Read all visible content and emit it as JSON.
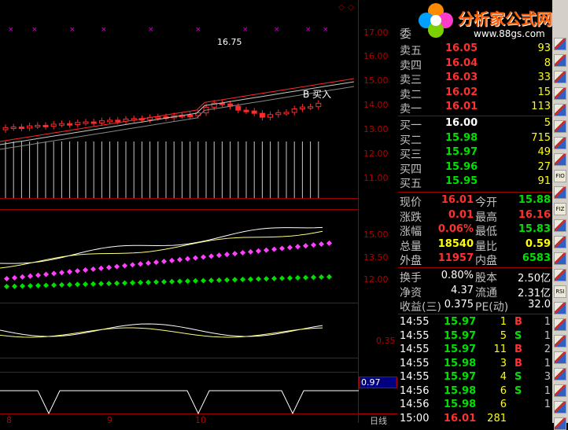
{
  "logo": {
    "text": "分析家公式网",
    "url": "www.88gs.com"
  },
  "main_chart": {
    "price_axis": [
      "17.00",
      "16.00",
      "15.00",
      "14.00",
      "13.00",
      "12.00",
      "11.00"
    ],
    "high_label": "16.75",
    "signal_label": "B 买入"
  },
  "indicator1": {
    "axis": [
      "15.00",
      "13.50",
      "12.00"
    ]
  },
  "indicator2": {
    "axis": [
      "0.35"
    ]
  },
  "indicator3": {
    "value": "0.97"
  },
  "x_axis": [
    "8",
    "9",
    "10"
  ],
  "period_tab": "日线",
  "quote": {
    "header": "委",
    "sell": [
      {
        "label": "卖五",
        "price": "16.05",
        "vol": "93"
      },
      {
        "label": "卖四",
        "price": "16.04",
        "vol": "8"
      },
      {
        "label": "卖三",
        "price": "16.03",
        "vol": "33"
      },
      {
        "label": "卖二",
        "price": "16.02",
        "vol": "15"
      },
      {
        "label": "卖一",
        "price": "16.01",
        "vol": "113"
      }
    ],
    "buy": [
      {
        "label": "买一",
        "price": "16.00",
        "vol": "5"
      },
      {
        "label": "买二",
        "price": "15.98",
        "vol": "715"
      },
      {
        "label": "买三",
        "price": "15.97",
        "vol": "49"
      },
      {
        "label": "买四",
        "price": "15.96",
        "vol": "27"
      },
      {
        "label": "买五",
        "price": "15.95",
        "vol": "91"
      }
    ],
    "stats": [
      {
        "l1": "现价",
        "v1": "16.01",
        "l2": "今开",
        "v2": "15.88"
      },
      {
        "l1": "涨跌",
        "v1": "0.01",
        "l2": "最高",
        "v2": "16.16"
      },
      {
        "l1": "涨幅",
        "v1": "0.06%",
        "l2": "最低",
        "v2": "15.83"
      },
      {
        "l1": "总量",
        "v1": "18540",
        "l2": "量比",
        "v2": "0.59"
      },
      {
        "l1": "外盘",
        "v1": "11957",
        "l2": "内盘",
        "v2": "6583"
      }
    ],
    "fin": [
      {
        "l1": "换手",
        "v1": "0.80%",
        "l2": "股本",
        "v2": "2.50亿"
      },
      {
        "l1": "净资",
        "v1": "4.37",
        "l2": "流通",
        "v2": "2.31亿"
      },
      {
        "l1": "收益(三)",
        "v1": "0.375",
        "l2": "PE(动)",
        "v2": "32.0"
      }
    ],
    "ticks": [
      {
        "time": "14:55",
        "price": "15.97",
        "vol": "1",
        "side": "B",
        "n": "1"
      },
      {
        "time": "14:55",
        "price": "15.97",
        "vol": "5",
        "side": "S",
        "n": "1"
      },
      {
        "time": "14:55",
        "price": "15.97",
        "vol": "11",
        "side": "B",
        "n": "2"
      },
      {
        "time": "14:55",
        "price": "15.98",
        "vol": "3",
        "side": "B",
        "n": "1"
      },
      {
        "time": "14:55",
        "price": "15.97",
        "vol": "4",
        "side": "S",
        "n": "3"
      },
      {
        "time": "14:56",
        "price": "15.98",
        "vol": "6",
        "side": "S",
        "n": "1"
      },
      {
        "time": "14:56",
        "price": "15.98",
        "vol": "6",
        "side": "",
        "n": "1"
      },
      {
        "time": "15:00",
        "price": "16.01",
        "vol": "281",
        "side": "",
        "n": ""
      }
    ]
  },
  "toolbar": {
    "items": [
      "tb1",
      "tb2",
      "tb3",
      "tb4",
      "tb5",
      "tb6",
      "tb7",
      "tb8",
      "FIO",
      "tb10",
      "FIZ",
      "tb12",
      "tb13",
      "tb14",
      "tb15",
      "RSI",
      "tb17",
      "tb18",
      "tb19",
      "tb20",
      "tb21",
      "tb22",
      "tb23",
      "tb24"
    ]
  },
  "colors": {
    "up": "#ff2a2a",
    "down": "#00d8d8",
    "green": "#00e000",
    "yellow": "#ffff00",
    "white": "#ffffff",
    "magenta": "#ff40ff"
  }
}
